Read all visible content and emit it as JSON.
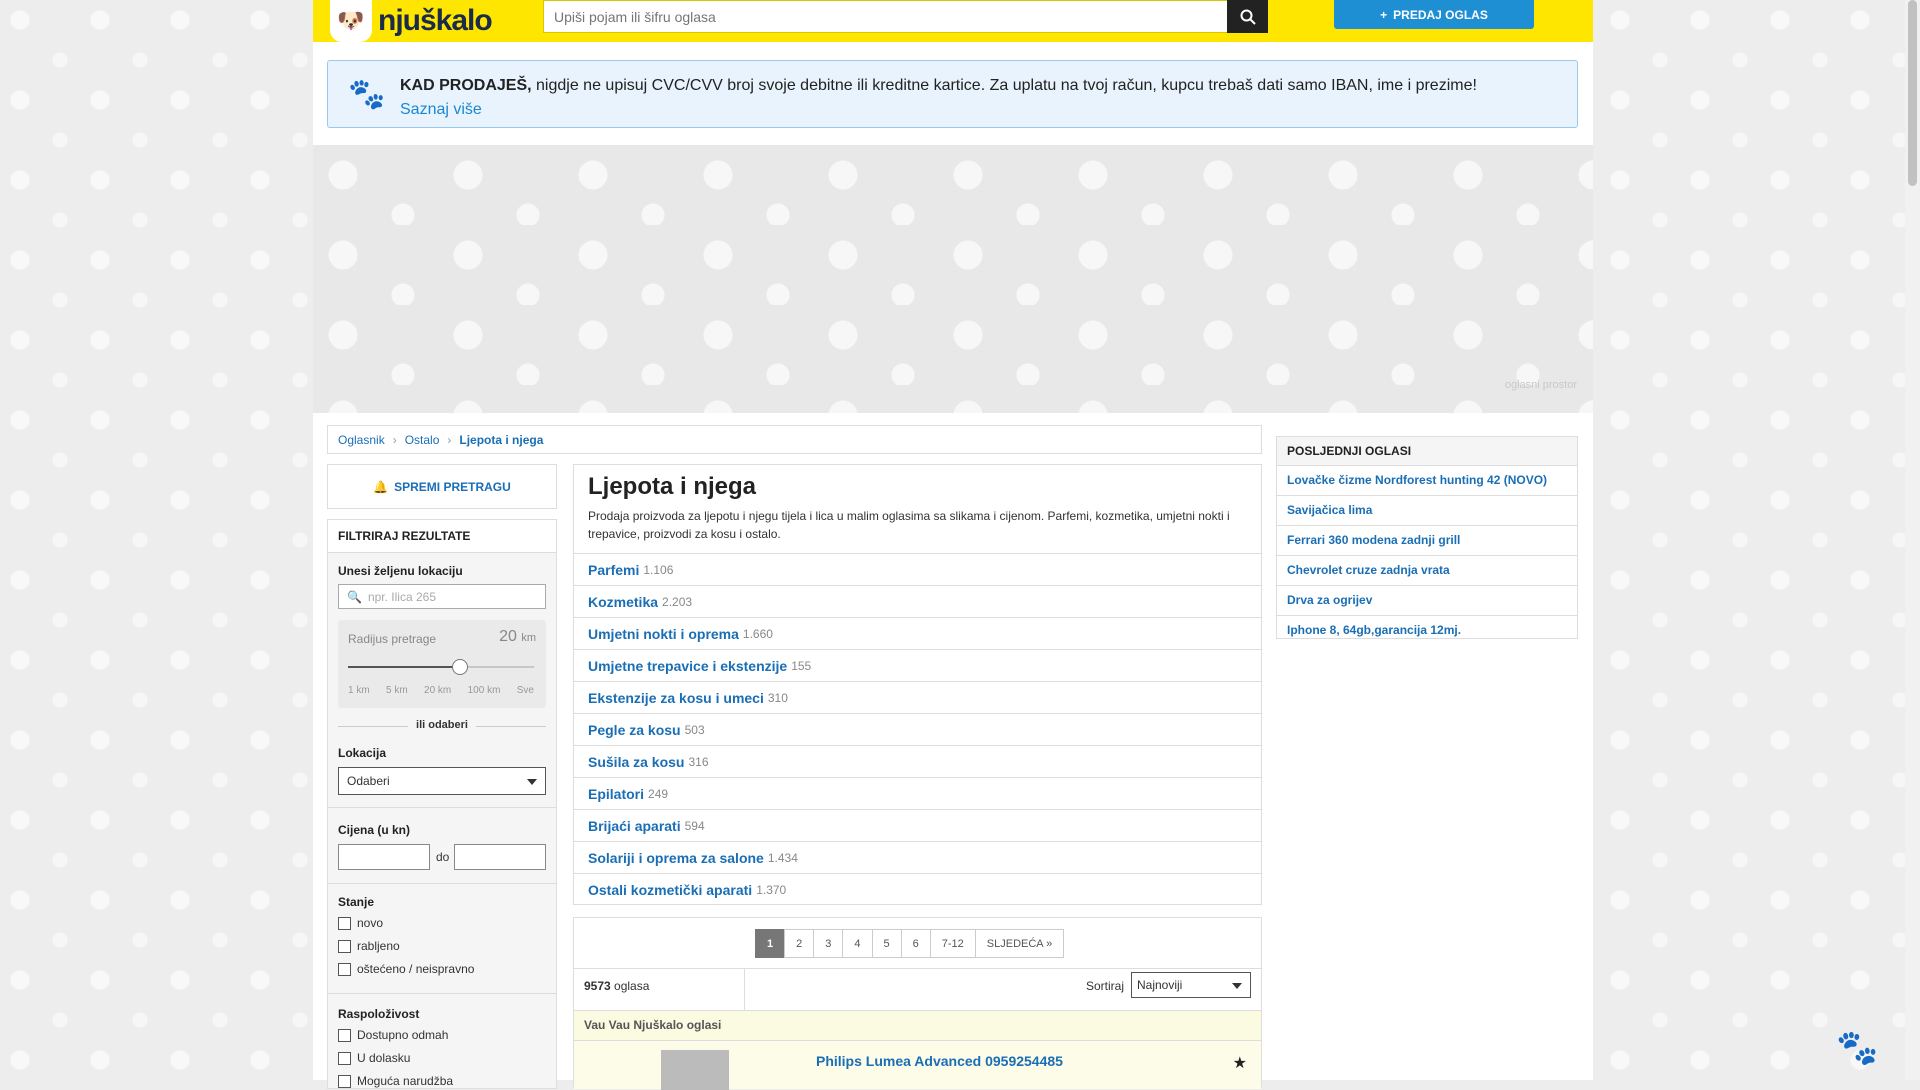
{
  "header": {
    "logo_text": "njuškalo",
    "search_placeholder": "Upiši pojam ili šifru oglasa",
    "search_icon": "search-icon",
    "sell_label": "PREDAJ OGLAS",
    "colors": {
      "header_bg": "#ffe600",
      "accent": "#1f8fd4"
    }
  },
  "notice": {
    "bold": "KAD PRODAJEŠ,",
    "text": "nigdje ne upisuj CVC/CVV broj svoje debitne ili kreditne kartice. Za uplatu na tvoj račun, kupcu trebaš dati samo IBAN, ime i prezime!",
    "link": "Saznaj više"
  },
  "ad": {
    "label": "oglasni prostor"
  },
  "breadcrumb": [
    "Oglasnik",
    "Ostalo",
    "Ljepota i njega"
  ],
  "save_search": "SPREMI PRETRAGU",
  "filters": {
    "title": "FILTRIRAJ REZULTATE",
    "location_label": "Unesi željenu lokaciju",
    "location_placeholder": "npr. Ilica 265",
    "radius_label": "Radijus pretrage",
    "radius_value": "20",
    "radius_unit": "km",
    "radius_fraction": 0.6,
    "radius_ticks": [
      "1 km",
      "5 km",
      "20 km",
      "100 km",
      "Sve"
    ],
    "or_label": "ili odaberi",
    "lokacija_label": "Lokacija",
    "lokacija_value": "Odaberi",
    "price_label": "Cijena (u kn)",
    "price_to": "do",
    "stanje_label": "Stanje",
    "stanje_options": [
      "novo",
      "rabljeno",
      "oštećeno / neispravno"
    ],
    "raspolozivost_label": "Raspoloživost",
    "raspolozivost_options": [
      "Dostupno odmah",
      "U dolasku",
      "Moguća narudžba"
    ]
  },
  "category": {
    "title": "Ljepota i njega",
    "description": "Prodaja proizvoda za ljepotu i njegu tijela i lica u malim oglasima sa slikama i cijenom. Parfemi, kozmetika, umjetni nokti i trepavice, proizvodi za kosu i ostalo.",
    "items": [
      {
        "name": "Parfemi",
        "count": "1.106"
      },
      {
        "name": "Kozmetika",
        "count": "2.203"
      },
      {
        "name": "Umjetni nokti i oprema",
        "count": "1.660"
      },
      {
        "name": "Umjetne trepavice i ekstenzije",
        "count": "155"
      },
      {
        "name": "Ekstenzije za kosu i umeci",
        "count": "310"
      },
      {
        "name": "Pegle za kosu",
        "count": "503"
      },
      {
        "name": "Sušila za kosu",
        "count": "316"
      },
      {
        "name": "Epilatori",
        "count": "249"
      },
      {
        "name": "Brijaći aparati",
        "count": "594"
      },
      {
        "name": "Solariji i oprema za salone",
        "count": "1.434"
      },
      {
        "name": "Ostali kozmetički aparati",
        "count": "1.370"
      }
    ]
  },
  "pagination": [
    "1",
    "2",
    "3",
    "4",
    "5",
    "6",
    "7-12",
    "SLJEDEĆA »"
  ],
  "listing": {
    "count": "9573",
    "count_label": "oglasa",
    "sort_label": "Sortiraj",
    "sort_value": "Najnoviji",
    "vau_header": "Vau Vau Njuškalo oglasi",
    "vau_title": "Philips Lumea Advanced 0959254485"
  },
  "latest": {
    "title": "POSLJEDNJI OGLASI",
    "items": [
      "Lovačke čizme Nordforest hunting 42 (NOVO)",
      "Savijačica lima",
      "Ferrari 360 modena zadnji grill",
      "Chevrolet cruze zadnja vrata",
      "Drva za ogrijev",
      "Iphone 8, 64gb,garancija 12mj."
    ]
  }
}
